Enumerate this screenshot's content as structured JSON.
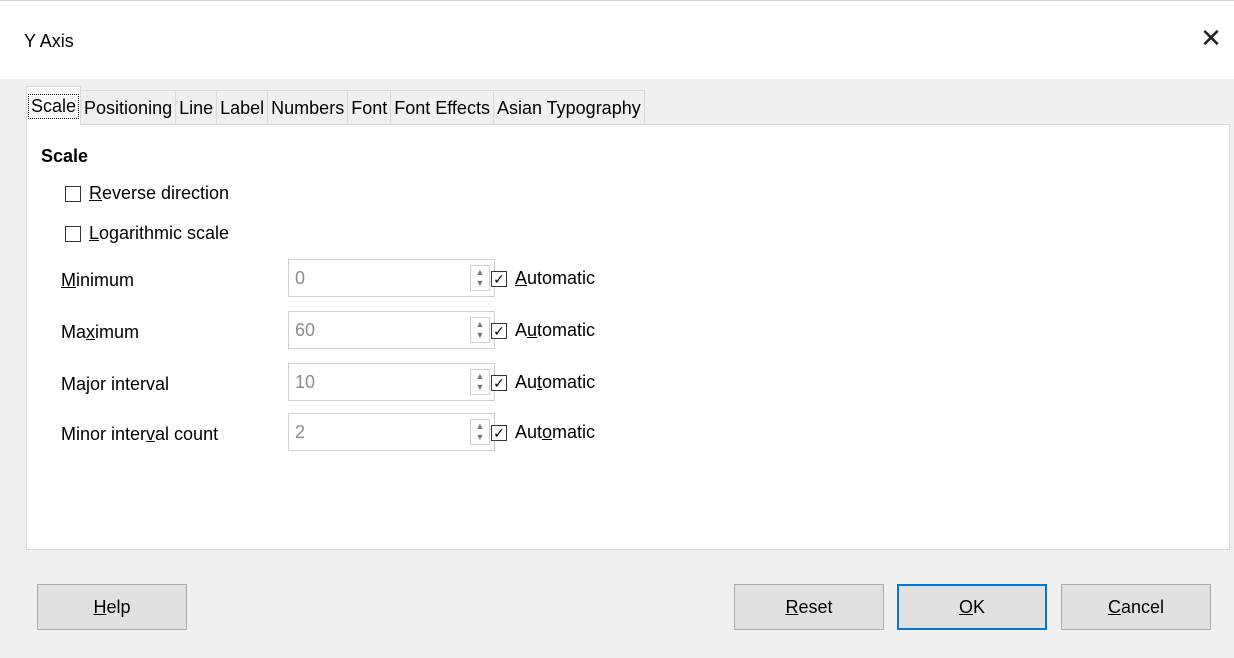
{
  "window": {
    "title": "Y Axis",
    "close_glyph": "✕"
  },
  "tabs": [
    {
      "label": "Scale",
      "active": true
    },
    {
      "label": "Positioning"
    },
    {
      "label": "Line"
    },
    {
      "label": "Label"
    },
    {
      "label": "Numbers"
    },
    {
      "label": "Font"
    },
    {
      "label": "Font Effects"
    },
    {
      "label": "Asian Typography"
    }
  ],
  "scale": {
    "section_title": "Scale",
    "reverse": {
      "label_mn": "R",
      "label_rest": "everse direction",
      "checked": false
    },
    "log": {
      "label_mn": "L",
      "label_rest": "ogarithmic scale",
      "checked": false
    },
    "fields": [
      {
        "label_pre": "",
        "label_mn": "M",
        "label_post": "inimum",
        "value": "0",
        "auto_pre": "",
        "auto_mn": "A",
        "auto_post": "utomatic",
        "auto_checked": true
      },
      {
        "label_pre": "Ma",
        "label_mn": "x",
        "label_post": "imum",
        "value": "60",
        "auto_pre": "A",
        "auto_mn": "u",
        "auto_post": "tomatic",
        "auto_checked": true
      },
      {
        "label_pre": "Ma",
        "label_mn": "j",
        "label_post": "or interval",
        "value": "10",
        "auto_pre": "Au",
        "auto_mn": "t",
        "auto_post": "omatic",
        "auto_checked": true
      },
      {
        "label_pre": "Minor inter",
        "label_mn": "v",
        "label_post": "al count",
        "value": "2",
        "auto_pre": "Aut",
        "auto_mn": "o",
        "auto_post": "matic",
        "auto_checked": true
      }
    ]
  },
  "buttons": {
    "help": {
      "mn": "H",
      "rest": "elp"
    },
    "reset": {
      "mn": "R",
      "rest": "eset"
    },
    "ok": {
      "mn": "O",
      "rest": "K"
    },
    "cancel": {
      "mn": "C",
      "rest": "ancel"
    }
  },
  "icons": {
    "check": "✓",
    "spin_up": "▲",
    "spin_down": "▼"
  },
  "colors": {
    "default_button_border": "#0078d7",
    "disabled_text": "#8c8c8c"
  }
}
